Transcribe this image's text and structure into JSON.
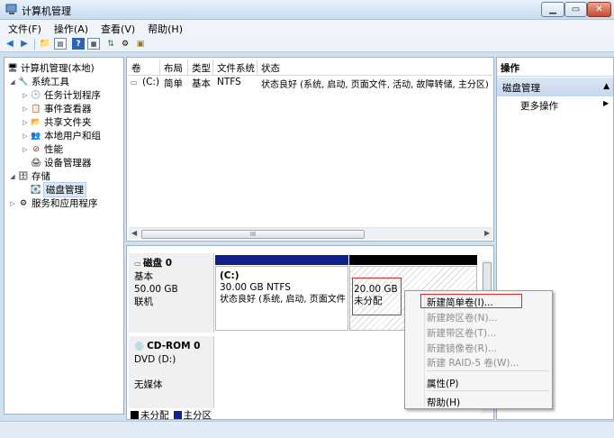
{
  "window": {
    "title": "计算机管理"
  },
  "menubar": [
    "文件(F)",
    "操作(A)",
    "查看(V)",
    "帮助(H)"
  ],
  "tree": {
    "root": "计算机管理(本地)",
    "system_tools": "系统工具",
    "task_scheduler": "任务计划程序",
    "event_viewer": "事件查看器",
    "shared_folders": "共享文件夹",
    "local_users": "本地用户和组",
    "performance": "性能",
    "device_manager": "设备管理器",
    "storage": "存储",
    "disk_management": "磁盘管理",
    "services": "服务和应用程序"
  },
  "volume_table": {
    "columns": [
      "卷",
      "布局",
      "类型",
      "文件系统",
      "状态"
    ],
    "rows": [
      {
        "volume": "(C:)",
        "layout": "简单",
        "type": "基本",
        "fs": "NTFS",
        "status": "状态良好 (系统, 启动, 页面文件, 活动, 故障转储, 主分区)"
      }
    ]
  },
  "disks": {
    "disk0": {
      "name": "磁盘 0",
      "kind": "基本",
      "size": "50.00 GB",
      "status": "联机",
      "part_c": {
        "label": "(C:)",
        "size": "30.00 GB NTFS",
        "status": "状态良好 (系统, 启动, 页面文件"
      },
      "unalloc": {
        "size": "20.00 GB",
        "label": "未分配"
      }
    },
    "cdrom0": {
      "name": "CD-ROM 0",
      "drive": "DVD (D:)",
      "status": "无媒体"
    }
  },
  "legend": {
    "unallocated": "未分配",
    "primary": "主分区"
  },
  "actions": {
    "title": "操作",
    "section": "磁盘管理",
    "more": "更多操作"
  },
  "context_menu": {
    "new_simple": "新建简单卷(I)...",
    "new_spanned": "新建跨区卷(N)...",
    "new_striped": "新建带区卷(T)...",
    "new_mirrored": "新建镜像卷(R)...",
    "new_raid5": "新建 RAID-5 卷(W)...",
    "properties": "属性(P)",
    "help": "帮助(H)"
  },
  "colors": {
    "primary_partition": "#0f1f8c",
    "unallocated": "#000000",
    "highlight": "#e0262b"
  }
}
